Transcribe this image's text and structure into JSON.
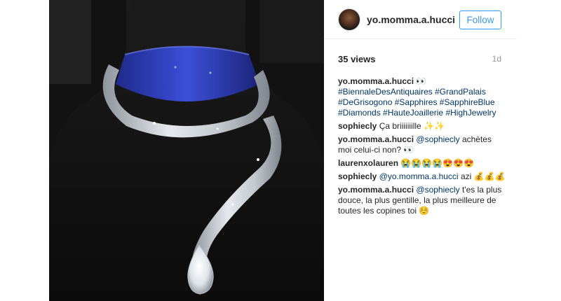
{
  "post": {
    "username": "yo.momma.a.hucci",
    "follow_label": "Follow",
    "views": "35 views",
    "time_ago": "1d"
  },
  "caption": {
    "username": "yo.momma.a.hucci",
    "text": "👀",
    "hashtags": [
      "#BiennaleDesAntiquaires",
      "#GrandPalais",
      "#DeGrisogono",
      "#Sapphires",
      "#SapphireBlue",
      "#Diamonds",
      "#HauteJoaillerie",
      "#HighJewelry"
    ]
  },
  "comments": [
    {
      "username": "sophiecly",
      "text": "Ça briiiiiiille ✨✨"
    },
    {
      "username": "yo.momma.a.hucci",
      "mention": "@sophiecly",
      "text": "achètes moi celui-ci non? 👀"
    },
    {
      "username": "laurenxolauren",
      "text": "😭😭😭😭😍😍😍"
    },
    {
      "username": "sophiecly",
      "mention": "@yo.momma.a.hucci",
      "text": "azi 💰💰💰"
    },
    {
      "username": "yo.momma.a.hucci",
      "mention": "@sophiecly",
      "text": "t'es la plus douce, la plus gentille, la plus meilleure de toutes les copines toi ☺️"
    }
  ],
  "icons": {
    "avatar": "user-avatar",
    "photo": "jewelry-photo"
  }
}
